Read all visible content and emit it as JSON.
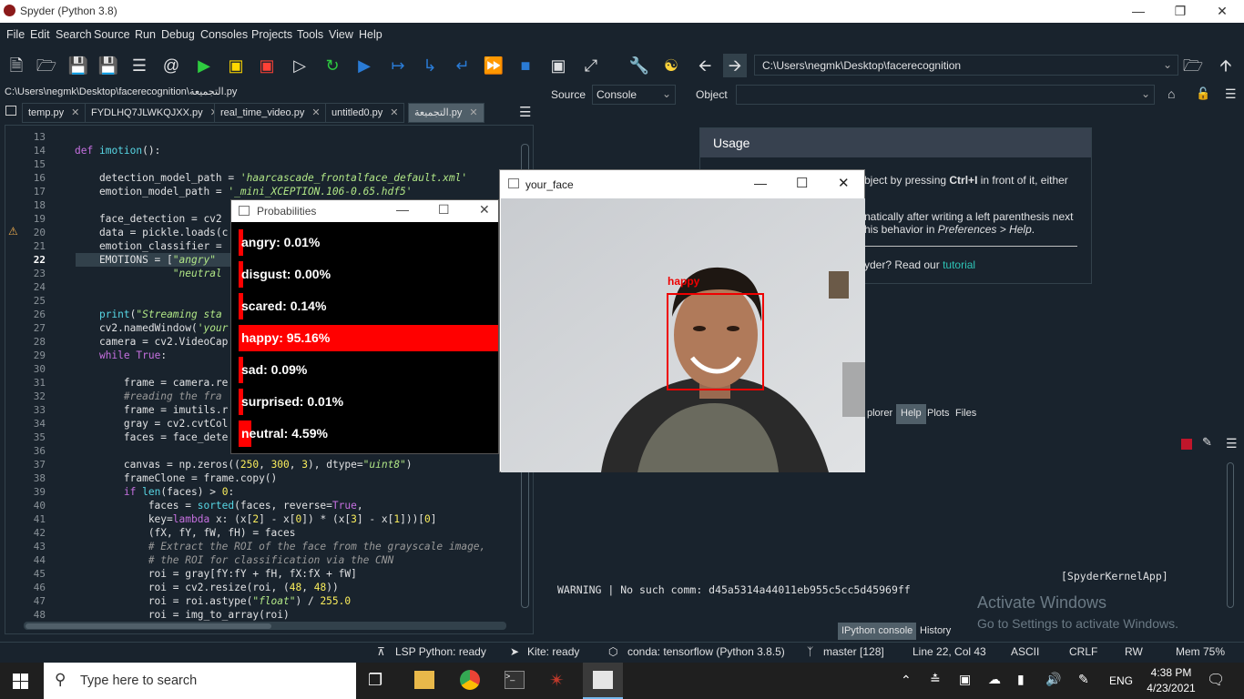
{
  "window": {
    "title": "Spyder (Python 3.8)"
  },
  "menu": [
    "File",
    "Edit",
    "Search",
    "Source",
    "Run",
    "Debug",
    "Consoles",
    "Projects",
    "Tools",
    "View",
    "Help"
  ],
  "toolbar": {
    "path": "C:\\Users\\negmk\\Desktop\\facerecognition"
  },
  "editor": {
    "filepath": "C:\\Users\\negmk\\Desktop\\facerecognition\\التجميعة.py",
    "tabs": [
      "temp.py",
      "FYDLHQ7JLWKQJXX.py",
      "real_time_video.py",
      "untitled0.py",
      "التجميعة.py"
    ],
    "line_numbers": [
      "13",
      "14",
      "15",
      "16",
      "17",
      "18",
      "19",
      "20",
      "21",
      "22",
      "23",
      "24",
      "25",
      "26",
      "27",
      "28",
      "29",
      "30",
      "31",
      "32",
      "33",
      "34",
      "35",
      "36",
      "37",
      "38",
      "39",
      "40",
      "41",
      "42",
      "43",
      "44",
      "45",
      "46",
      "47",
      "48"
    ],
    "current_line": "22"
  },
  "rightpanel": {
    "source_label": "Source",
    "source_value": "Console",
    "object_label": "Object",
    "usage_title": "Usage",
    "usage_line1_pre": "bject by pressing ",
    "usage_line1_key": "Ctrl+I",
    "usage_line1_post": " in front of it, either",
    "usage_line2": "natically after writing a left parenthesis next",
    "usage_line3_pre": "his behavior in ",
    "usage_line3_em": "Preferences > Help",
    "usage_line4_pre": "yder? Read our ",
    "usage_line4_link": "tutorial",
    "tabs": [
      "plorer",
      "Help",
      "Plots",
      "Files"
    ]
  },
  "console": {
    "kernel_line": "[SpyderKernelApp]",
    "warning": "WARNING | No such comm: d45a5314a44011eb955c5cc5d45969ff",
    "tabs": [
      "IPython console",
      "History"
    ]
  },
  "watermark": {
    "line1": "Activate Windows",
    "line2": "Go to Settings to activate Windows."
  },
  "statusbar": {
    "lsp": "LSP Python: ready",
    "kite": "Kite: ready",
    "conda": "conda: tensorflow (Python 3.8.5)",
    "git": "master [128]",
    "pos": "Line 22, Col 43",
    "encoding": "ASCII",
    "eol": "CRLF",
    "rw": "RW",
    "mem": "Mem 75%"
  },
  "probabilities": {
    "title": "Probabilities",
    "bars": [
      {
        "label": "angry: 0.01%",
        "value": 0.01
      },
      {
        "label": "disgust: 0.00%",
        "value": 0.0
      },
      {
        "label": "scared: 0.14%",
        "value": 0.14
      },
      {
        "label": "happy: 95.16%",
        "value": 95.16
      },
      {
        "label": "sad: 0.09%",
        "value": 0.09
      },
      {
        "label": "surprised: 0.01%",
        "value": 0.01
      },
      {
        "label": "neutral: 4.59%",
        "value": 4.59
      }
    ]
  },
  "face_window": {
    "title": "your_face",
    "detection_label": "happy"
  },
  "taskbar": {
    "search_placeholder": "Type here to search",
    "time": "4:38 PM",
    "date": "4/23/2021",
    "lang": "ENG"
  }
}
